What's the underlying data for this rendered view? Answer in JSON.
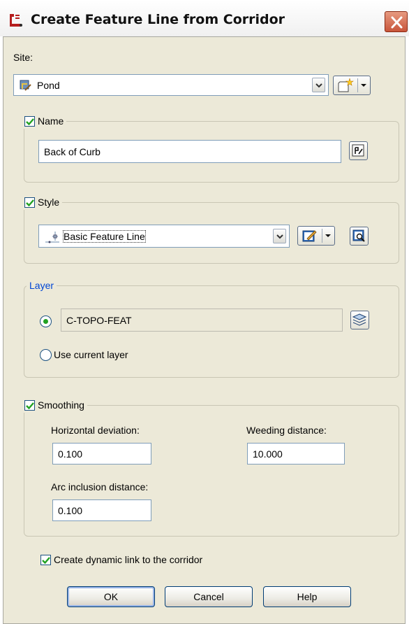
{
  "window": {
    "title": "Create Feature Line from Corridor",
    "icon": "feature-line-app-icon",
    "close_icon": "close-icon",
    "colors": {
      "face": "#ece9d8",
      "group_title_blue": "#0046d5",
      "close_red": "#c8553a",
      "check_green": "#21a121"
    }
  },
  "site": {
    "label": "Site:",
    "value": "Pond",
    "icon": "site-icon",
    "new_button_icon": "create-new-site-icon"
  },
  "name": {
    "checkbox_label": "Name",
    "checked": true,
    "value": "Back of Curb",
    "edit_button_icon": "name-template-icon"
  },
  "style": {
    "checkbox_label": "Style",
    "checked": true,
    "value": "Basic Feature Line",
    "icon": "feature-line-style-icon",
    "edit_button_icon": "edit-style-icon",
    "preview_button_icon": "preview-style-icon"
  },
  "layer": {
    "group_label": "Layer",
    "selected_option": "layer",
    "layer_value": "C-TOPO-FEAT",
    "layer_button_icon": "layer-icon",
    "current_layer_label": "Use current layer"
  },
  "smoothing": {
    "checkbox_label": "Smoothing",
    "checked": true,
    "horizontal_deviation_label": "Horizontal deviation:",
    "horizontal_deviation_value": "0.100",
    "weeding_distance_label": "Weeding distance:",
    "weeding_distance_value": "10.000",
    "arc_inclusion_label": "Arc inclusion distance:",
    "arc_inclusion_value": "0.100"
  },
  "dynamic_link": {
    "label": "Create dynamic link to the corridor",
    "checked": true
  },
  "buttons": {
    "ok": "OK",
    "cancel": "Cancel",
    "help": "Help"
  }
}
